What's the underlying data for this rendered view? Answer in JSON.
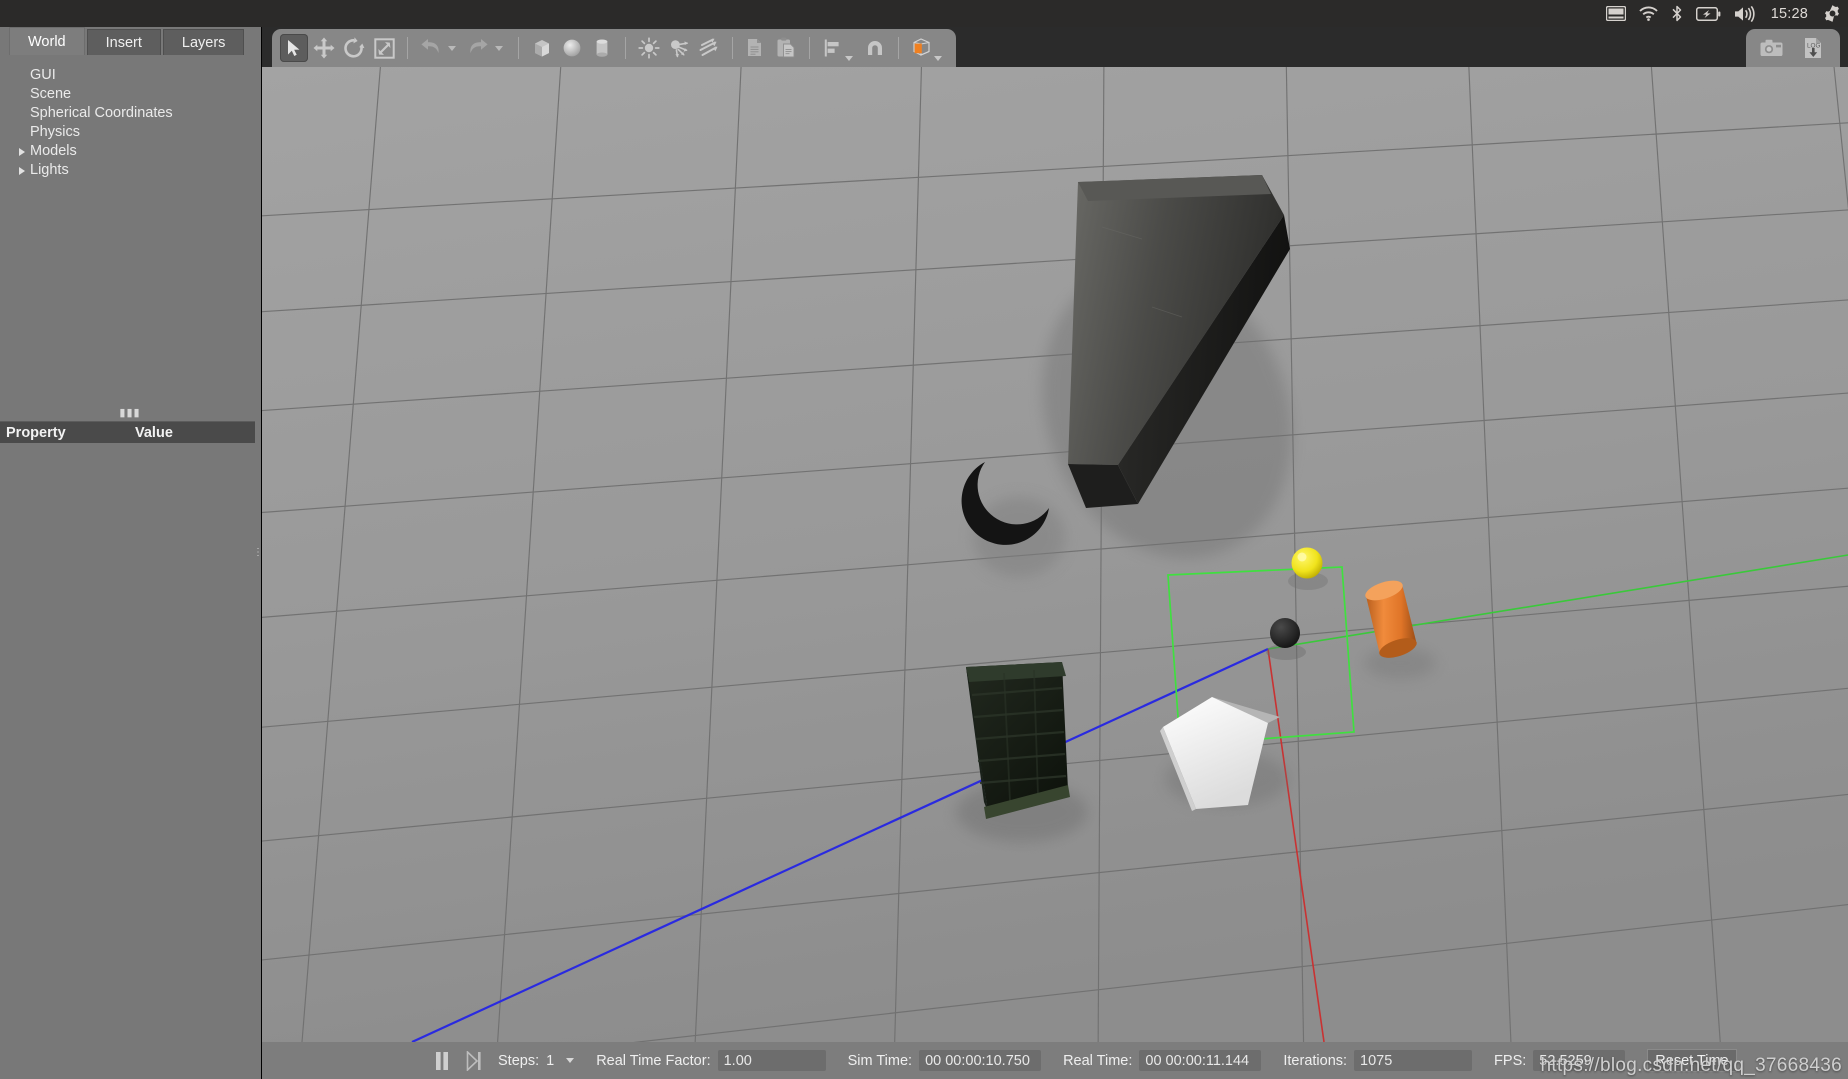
{
  "system_panel": {
    "icons": [
      "keyboard-indicator-icon",
      "wifi-icon",
      "bluetooth-icon",
      "battery-charging-icon",
      "volume-icon"
    ],
    "clock": "15:28",
    "settings_icon": "gear-icon"
  },
  "left_panel": {
    "tabs": [
      {
        "label": "World",
        "active": true
      },
      {
        "label": "Insert",
        "active": false
      },
      {
        "label": "Layers",
        "active": false
      }
    ],
    "tree": [
      {
        "label": "GUI",
        "expandable": false
      },
      {
        "label": "Scene",
        "expandable": false
      },
      {
        "label": "Spherical Coordinates",
        "expandable": false
      },
      {
        "label": "Physics",
        "expandable": false
      },
      {
        "label": "Models",
        "expandable": true
      },
      {
        "label": "Lights",
        "expandable": true
      }
    ],
    "property_table": {
      "col_property": "Property",
      "col_value": "Value"
    }
  },
  "toolbar": {
    "left_buttons": [
      {
        "name": "select-mode-button",
        "icon": "cursor-arrow-icon",
        "active": true
      },
      {
        "name": "translate-mode-button",
        "icon": "move-arrows-icon",
        "active": false
      },
      {
        "name": "rotate-mode-button",
        "icon": "rotate-icon",
        "active": false
      },
      {
        "name": "scale-mode-button",
        "icon": "scale-icon",
        "active": false
      },
      {
        "name": "undo-button",
        "icon": "undo-arrow-icon",
        "active": false
      },
      {
        "name": "redo-button",
        "icon": "redo-arrow-icon",
        "active": false
      },
      {
        "name": "insert-box-button",
        "icon": "cube-icon",
        "active": false
      },
      {
        "name": "insert-sphere-button",
        "icon": "sphere-icon",
        "active": false
      },
      {
        "name": "insert-cylinder-button",
        "icon": "cylinder-icon",
        "active": false
      },
      {
        "name": "insert-point-light-button",
        "icon": "point-light-icon",
        "active": false
      },
      {
        "name": "insert-spot-light-button",
        "icon": "spot-light-icon",
        "active": false
      },
      {
        "name": "insert-directional-light-button",
        "icon": "directional-light-icon",
        "active": false
      },
      {
        "name": "copy-button",
        "icon": "copy-icon",
        "active": false
      },
      {
        "name": "paste-button",
        "icon": "paste-icon",
        "active": false
      },
      {
        "name": "align-button",
        "icon": "align-icon",
        "active": false
      },
      {
        "name": "snap-button",
        "icon": "magnet-snap-icon",
        "active": false
      },
      {
        "name": "view-color-button",
        "icon": "orange-cube-icon",
        "active": false
      }
    ],
    "accent_color": "#f08020",
    "right_buttons": [
      {
        "name": "screenshot-button",
        "icon": "camera-icon"
      },
      {
        "name": "log-record-button",
        "icon": "log-download-icon",
        "label": "LOG"
      }
    ]
  },
  "status_bar": {
    "pause_icon": "pause-icon",
    "step_icon": "step-forward-icon",
    "steps_label": "Steps:",
    "steps_value": "1",
    "real_time_factor_label": "Real Time Factor:",
    "real_time_factor_value": "1.00",
    "sim_time_label": "Sim Time:",
    "sim_time_value": "00 00:00:10.750",
    "real_time_label": "Real Time:",
    "real_time_value": "00 00:00:11.144",
    "iterations_label": "Iterations:",
    "iterations_value": "1075",
    "fps_label": "FPS:",
    "fps_value": "52.5259",
    "reset_time_label": "Reset Time"
  },
  "watermark": "https://blog.csdn.net/qq_37668436",
  "scene": {
    "description": "Gazebo 3D viewport with ground grid, selected model bounding box, and axis lines",
    "ground_color": "#9a9a9a",
    "grid_color": "#6e6e6e",
    "selection_box_color": "#33dd33",
    "x_axis_color": "#cc2222",
    "y_axis_color": "#22cc22",
    "z_axis_color": "#2222dd",
    "objects": [
      {
        "name": "concrete-beam",
        "color": "#3a3a3a"
      },
      {
        "name": "crescent-shape",
        "color": "#222222"
      },
      {
        "name": "yellow-sphere",
        "color": "#e8e020"
      },
      {
        "name": "dark-sphere",
        "color": "#2a2a2a"
      },
      {
        "name": "orange-cylinder",
        "color": "#e08030"
      },
      {
        "name": "solar-panel",
        "color": "#1b2a1b"
      },
      {
        "name": "white-plate",
        "color": "#f2f2f2"
      }
    ]
  }
}
